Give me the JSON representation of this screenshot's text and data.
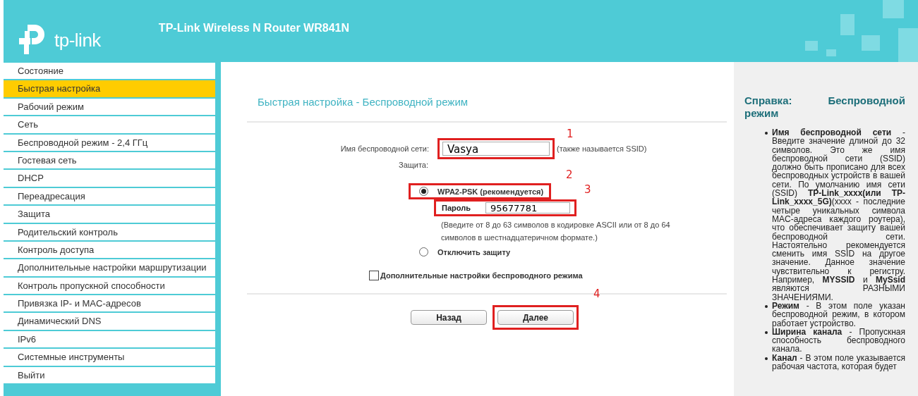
{
  "header": {
    "logo_text": "tp-link",
    "title": "TP-Link Wireless N Router WR841N"
  },
  "sidebar": {
    "items": [
      {
        "label": "Состояние",
        "selected": false
      },
      {
        "label": "Быстрая настройка",
        "selected": true
      },
      {
        "label": "Рабочий режим",
        "selected": false
      },
      {
        "label": "Сеть",
        "selected": false
      },
      {
        "label": "Беспроводной режим - 2,4 ГГц",
        "selected": false
      },
      {
        "label": "Гостевая сеть",
        "selected": false
      },
      {
        "label": "DHCP",
        "selected": false
      },
      {
        "label": "Переадресация",
        "selected": false
      },
      {
        "label": "Защита",
        "selected": false
      },
      {
        "label": "Родительский контроль",
        "selected": false
      },
      {
        "label": "Контроль доступа",
        "selected": false
      },
      {
        "label": "Дополнительные настройки маршрутизации",
        "selected": false
      },
      {
        "label": "Контроль пропускной способности",
        "selected": false
      },
      {
        "label": "Привязка IP- и MAC-адресов",
        "selected": false
      },
      {
        "label": "Динамический DNS",
        "selected": false
      },
      {
        "label": "IPv6",
        "selected": false
      },
      {
        "label": "Системные инструменты",
        "selected": false
      },
      {
        "label": "Выйти",
        "selected": false
      }
    ]
  },
  "main": {
    "title": "Быстрая настройка - Беспроводной режим",
    "ssid": {
      "label": "Имя беспроводной сети:",
      "value": "Vasya",
      "hint": "(также называется SSID)",
      "annotation": "1"
    },
    "security": {
      "label": "Защита:",
      "options": [
        {
          "label": "WPA2-PSK (рекомендуется)",
          "selected": true,
          "annotation": "2",
          "password": {
            "label": "Пароль",
            "value": "95677781",
            "annotation": "3"
          },
          "hint": "(Введите от 8 до 63 символов в кодировке ASCII или от 8 до 64 символов в шестнадцатеричном формате.)"
        },
        {
          "label": "Отключить защиту",
          "selected": false
        }
      ]
    },
    "advanced": {
      "label": "Дополнительные настройки беспроводного режима",
      "checked": false
    },
    "buttons": [
      {
        "label": "Назад"
      },
      {
        "label": "Далее",
        "annotation": "4"
      }
    ]
  },
  "help": {
    "title": "Справка: Беспроводной режим",
    "items": [
      "**Имя беспроводной сети** - Введите значение длиной до 32 символов. Это же имя беспроводной сети (SSID) должно быть прописано для всех беспроводных устройств в вашей сети. По умолчанию имя сети (SSID) **TP-Link_xxxx(или TP-Link_xxxx_5G)**(xxxx - последние четыре уникальных символа MAC-адреса каждого роутера), что обеспечивает защиту вашей беспроводной сети. Настоятельно рекомендуется сменить имя SSID на другое значение. Данное значение чувствительно к регистру. Например, **MYSSID** и **MySsid** являются РАЗНЫМИ ЗНАЧЕНИЯМИ.",
      "**Режим** - В этом поле указан беспроводной режим, в котором работает устройство.",
      "**Ширина канала** - Пропускная способность беспроводного канала.",
      "**Канал** - В этом поле указывается рабочая частота, которая будет"
    ]
  }
}
